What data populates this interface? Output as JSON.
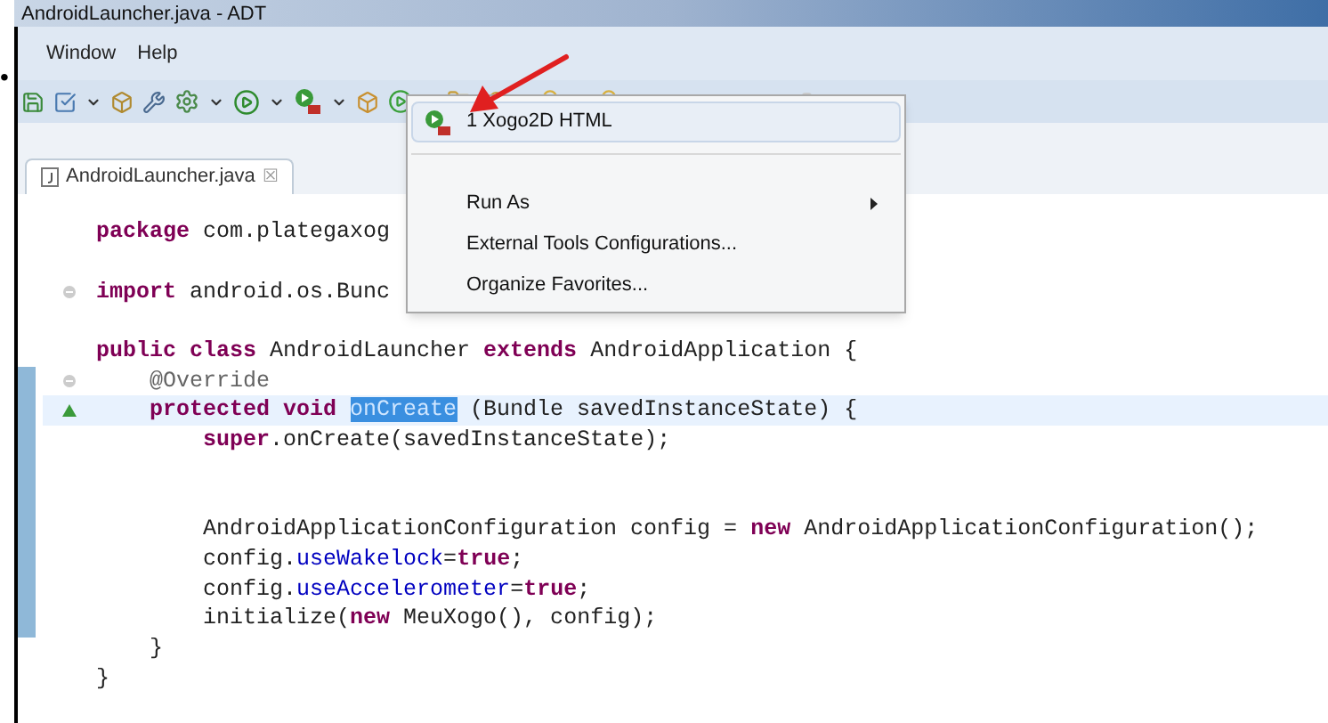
{
  "bullet": "•",
  "window": {
    "title": "AndroidLauncher.java - ADT"
  },
  "menu_bar": [
    "Window",
    "Help"
  ],
  "editor_tab": {
    "label": "AndroidLauncher.java",
    "close": "☒"
  },
  "code_lines": [
    {
      "fold_marker": false,
      "current": false,
      "tokens": [
        {
          "kind": "kw",
          "text": "package"
        },
        {
          "kind": "plain",
          "text": " com.plategaxog"
        }
      ]
    },
    {
      "current": false
    },
    {
      "fold_marker": true,
      "current": false,
      "tokens": [
        {
          "kind": "kw",
          "text": "import"
        },
        {
          "kind": "plain",
          "text": " android.os.Bunc"
        }
      ]
    },
    {
      "current": false
    },
    {
      "fold_marker": false,
      "current": false,
      "tokens": [
        {
          "kind": "kw",
          "text": "public class"
        },
        {
          "kind": "plain",
          "text": " AndroidLauncher "
        },
        {
          "kind": "kw",
          "text": "extends"
        },
        {
          "kind": "plain",
          "text": " AndroidApplication {"
        }
      ]
    },
    {
      "fold_marker": true,
      "current": false,
      "tokens": [
        {
          "kind": "ann",
          "text": "    @Override"
        }
      ]
    },
    {
      "fold_marker": false,
      "current": true,
      "tokens": [
        {
          "kind": "kw",
          "text": "    protected void "
        },
        {
          "kind": "hl",
          "text": "onCreate"
        },
        {
          "kind": "plain",
          "text": " (Bundle savedInstanceState) {"
        }
      ]
    },
    {
      "fold_marker": false,
      "current": false,
      "tokens": [
        {
          "kind": "kw",
          "text": "        super"
        },
        {
          "kind": "plain",
          "text": ".onCreate(savedInstanceState);"
        }
      ]
    },
    {
      "current": false
    },
    {
      "current": false
    },
    {
      "fold_marker": false,
      "current": false,
      "tokens": [
        {
          "kind": "plain",
          "text": "        AndroidApplicationConfiguration config = "
        },
        {
          "kind": "kw",
          "text": "new"
        },
        {
          "kind": "plain",
          "text": " AndroidApplicationConfiguration();"
        }
      ]
    },
    {
      "fold_marker": false,
      "current": false,
      "tokens": [
        {
          "kind": "plain",
          "text": "        config."
        },
        {
          "kind": "field",
          "text": "useWakelock"
        },
        {
          "kind": "plain",
          "text": "="
        },
        {
          "kind": "kw",
          "text": "true"
        },
        {
          "kind": "plain",
          "text": ";"
        }
      ]
    },
    {
      "fold_marker": false,
      "current": false,
      "tokens": [
        {
          "kind": "plain",
          "text": "        config."
        },
        {
          "kind": "field",
          "text": "useAccelerometer"
        },
        {
          "kind": "plain",
          "text": "="
        },
        {
          "kind": "kw",
          "text": "true"
        },
        {
          "kind": "plain",
          "text": ";"
        }
      ]
    },
    {
      "fold_marker": false,
      "current": false,
      "tokens": [
        {
          "kind": "plain",
          "text": "        initialize("
        },
        {
          "kind": "kw",
          "text": "new"
        },
        {
          "kind": "plain",
          "text": " MeuXogo(), config);"
        }
      ]
    },
    {
      "fold_marker": false,
      "current": false,
      "tokens": [
        {
          "kind": "plain",
          "text": "    }"
        }
      ]
    },
    {
      "fold_marker": false,
      "current": false,
      "tokens": [
        {
          "kind": "plain",
          "text": "}"
        }
      ]
    }
  ],
  "dropdown_menu": [
    {
      "kind": "launch",
      "label": "1 Xogo2D HTML",
      "selected": true
    },
    {
      "kind": "separator"
    },
    {
      "kind": "submenu",
      "label": "Run As",
      "selected": false
    },
    {
      "kind": "item",
      "label": "External Tools Configurations...",
      "selected": false
    },
    {
      "kind": "item",
      "label": "Organize Favorites...",
      "selected": false
    }
  ]
}
